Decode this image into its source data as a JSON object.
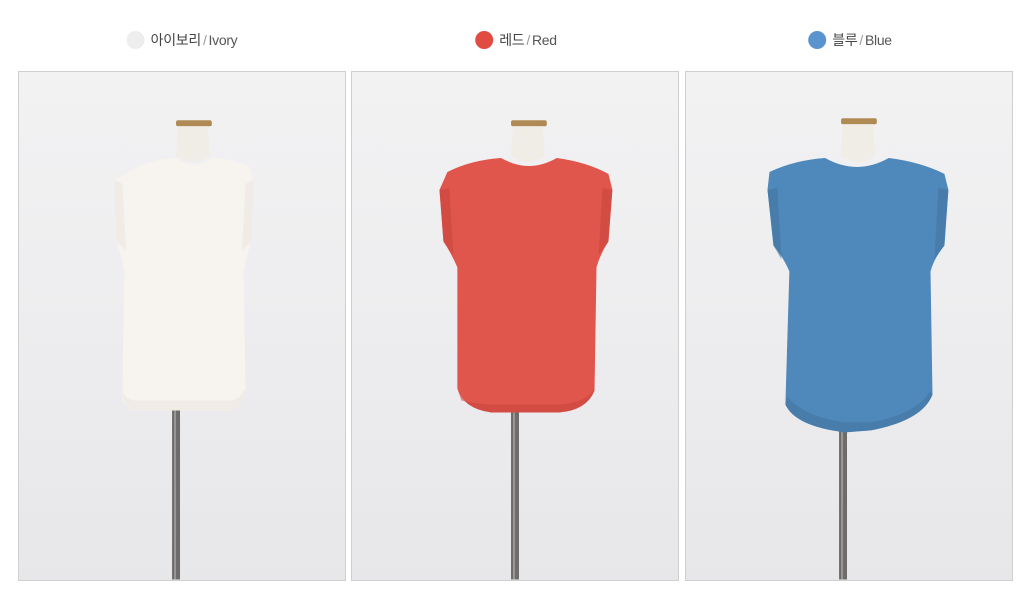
{
  "variants": [
    {
      "korean": "아이보리",
      "separator": "/",
      "english": "Ivory",
      "swatch_color": "#eeeeee",
      "shirt_color": "#f7f4f0",
      "shirt_shadow": "#e6e1da"
    },
    {
      "korean": "레드",
      "separator": "/",
      "english": "Red",
      "swatch_color": "#e24b42",
      "shirt_color": "#e0564c",
      "shirt_shadow": "#c9453d"
    },
    {
      "korean": "블루",
      "separator": "/",
      "english": "Blue",
      "swatch_color": "#5a94cf",
      "shirt_color": "#4f88bb",
      "shirt_shadow": "#41739f"
    }
  ]
}
